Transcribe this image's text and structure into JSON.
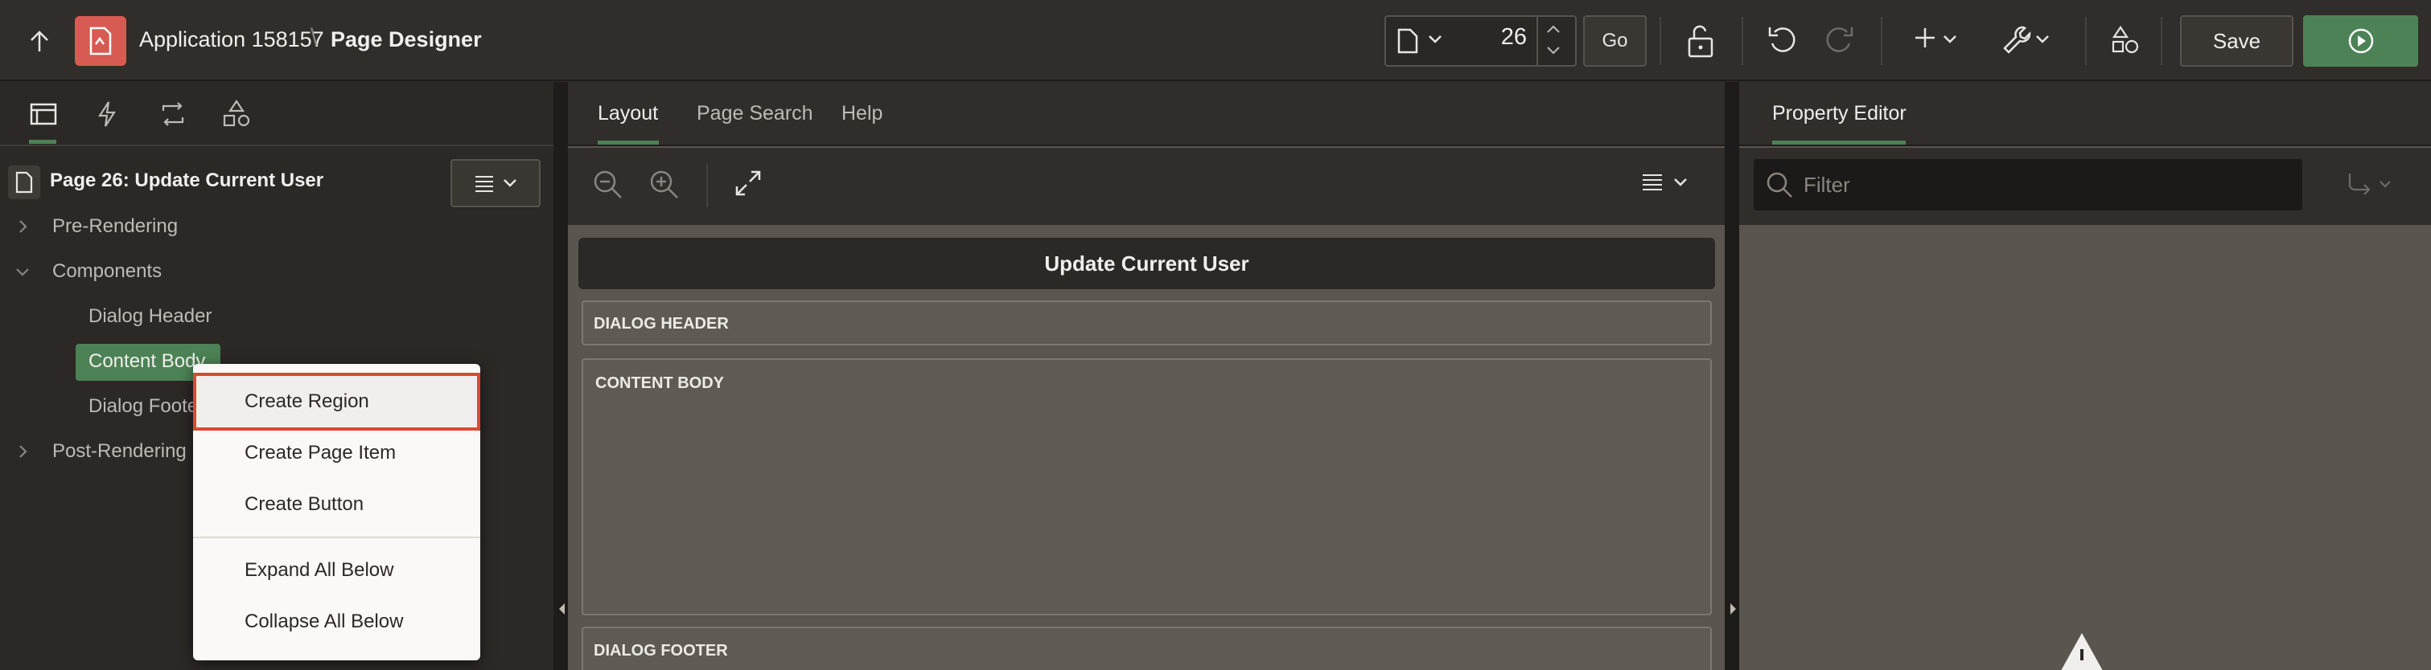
{
  "header": {
    "app_name": "Application 158157",
    "separator": "\\",
    "page_designer": "Page Designer",
    "page_number": "26",
    "go_label": "Go",
    "save_label": "Save"
  },
  "left": {
    "page_title": "Page 26: Update Current User",
    "tree": {
      "pre_rendering": "Pre-Rendering",
      "components": "Components",
      "dialog_header": "Dialog Header",
      "content_body": "Content Body",
      "dialog_footer": "Dialog Footer",
      "post_rendering": "Post-Rendering"
    }
  },
  "context_menu": {
    "items": [
      "Create Region",
      "Create Page Item",
      "Create Button",
      "Expand All Below",
      "Collapse All Below"
    ]
  },
  "center": {
    "tabs": [
      "Layout",
      "Page Search",
      "Help"
    ],
    "page_title": "Update Current User",
    "regions": {
      "dialog_header": "DIALOG HEADER",
      "content_body": "CONTENT BODY",
      "dialog_footer": "DIALOG FOOTER"
    }
  },
  "right": {
    "tab": "Property Editor",
    "filter_placeholder": "Filter"
  },
  "colors": {
    "accent": "#4c8255",
    "app_icon": "#d75b52",
    "highlight_border": "#d94a33"
  }
}
